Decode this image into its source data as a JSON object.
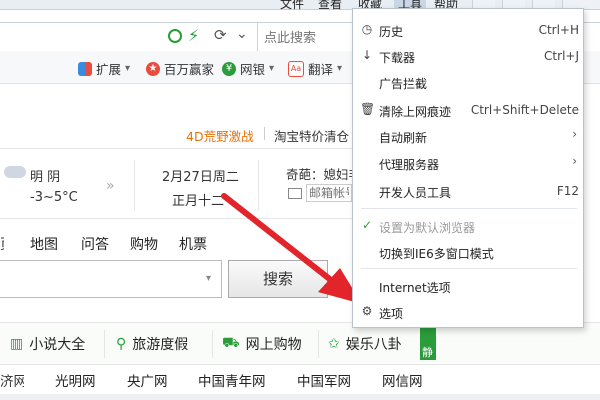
{
  "menubar": {
    "items": [
      "文件",
      "查看",
      "收藏",
      "工具",
      "帮助"
    ]
  },
  "addressbar": {
    "search_placeholder": "点此搜索"
  },
  "toolbar": {
    "items": [
      {
        "label": "扩展",
        "icon": "extensions-icon"
      },
      {
        "label": "百万赢家",
        "icon": "trophy-icon"
      },
      {
        "label": "网银",
        "icon": "bank-icon"
      },
      {
        "label": "翻译",
        "icon": "translate-icon"
      }
    ]
  },
  "page": {
    "promo1": "4D荒野激战",
    "promo2": "淘宝特价清仓",
    "weather_condition": "明 阴",
    "weather_temp": "-3~5°C",
    "date": "2月27日周二",
    "lunar": "正月十二",
    "news_snippet": "奇葩：媳妇非",
    "mailbox_placeholder": "邮箱帐号",
    "nav": [
      "地图",
      "问答",
      "购物",
      "机票"
    ],
    "search_button": "搜索",
    "categories": [
      "小说大全",
      "旅游度假",
      "网上购物",
      "娱乐八卦",
      "静"
    ],
    "sites": [
      "光明网",
      "央广网",
      "中国青年网",
      "中国军网",
      "网信网"
    ]
  },
  "tools_menu": {
    "items": [
      {
        "label": "历史",
        "shortcut": "Ctrl+H",
        "icon": "clock-icon"
      },
      {
        "label": "下载器",
        "shortcut": "Ctrl+J",
        "icon": "download-icon"
      },
      {
        "label": "广告拦截",
        "shortcut": "",
        "icon": ""
      },
      {
        "label": "清除上网痕迹",
        "shortcut": "Ctrl+Shift+Delete",
        "icon": "trash-icon"
      },
      {
        "label": "自动刷新",
        "shortcut": "",
        "icon": "",
        "submenu": true
      },
      {
        "label": "代理服务器",
        "shortcut": "",
        "icon": "",
        "submenu": true
      },
      {
        "label": "开发人员工具",
        "shortcut": "F12",
        "icon": ""
      },
      {
        "label": "设置为默认浏览器",
        "shortcut": "",
        "icon": "check-icon",
        "disabled": true
      },
      {
        "label": "切换到IE6多窗口模式",
        "shortcut": "",
        "icon": ""
      },
      {
        "label": "Internet选项",
        "shortcut": "",
        "icon": ""
      },
      {
        "label": "选项",
        "shortcut": "",
        "icon": "gear-icon"
      }
    ]
  },
  "colors": {
    "arrow": "#e2252b",
    "promo": "#e8730c",
    "green": "#2a9d3a"
  }
}
